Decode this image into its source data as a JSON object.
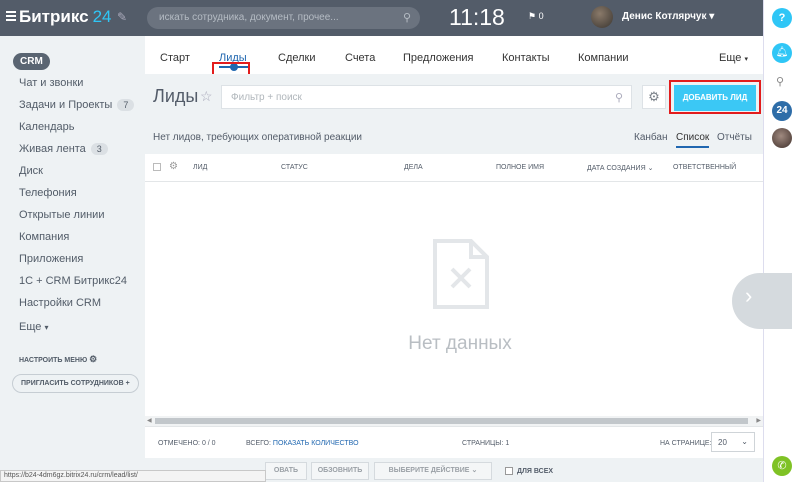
{
  "topbar": {
    "logo": "Битрикс",
    "logo_num": "24",
    "search_placeholder": "искать сотрудника, документ, прочее...",
    "clock": "11:18",
    "flag_count": "0",
    "username": "Денис Котлярчук"
  },
  "sidebar": {
    "crm": "CRM",
    "items": [
      {
        "label": "Чат и звонки"
      },
      {
        "label": "Задачи и Проекты",
        "count": "7"
      },
      {
        "label": "Календарь"
      },
      {
        "label": "Живая лента",
        "count": "3"
      },
      {
        "label": "Диск"
      },
      {
        "label": "Телефония"
      },
      {
        "label": "Открытые линии"
      },
      {
        "label": "Компания"
      },
      {
        "label": "Приложения"
      },
      {
        "label": "1С + CRM Битрикс24"
      },
      {
        "label": "Настройки CRM"
      },
      {
        "label": "Еще"
      }
    ],
    "configure": "НАСТРОИТЬ МЕНЮ",
    "invite": "ПРИГЛАСИТЬ СОТРУДНИКОВ"
  },
  "tabs": [
    "Старт",
    "Лиды",
    "Сделки",
    "Счета",
    "Предложения",
    "Контакты",
    "Компании",
    "Еще"
  ],
  "header": {
    "title": "Лиды",
    "filter_placeholder": "Фильтр + поиск",
    "add_button": "ДОБАВИТЬ ЛИД"
  },
  "info": {
    "text": "Нет лидов, требующих оперативной реакции",
    "views": [
      "Канбан",
      "Список",
      "Отчёты"
    ]
  },
  "columns": [
    "ЛИД",
    "СТАТУС",
    "ДЕЛА",
    "ПОЛНОЕ ИМЯ",
    "ДАТА СОЗДАНИЯ",
    "ОТВЕТСТВЕННЫЙ"
  ],
  "empty_text": "Нет данных",
  "footer": {
    "selected_label": "ОТМЕЧЕНО: 0 / 0",
    "total_label": "ВСЕГО:",
    "show_count": "ПОКАЗАТЬ КОЛИЧЕСТВО",
    "pages": "СТРАНИЦЫ: 1",
    "per_page_label": "НА СТРАНИЦЕ:",
    "per_page": "20"
  },
  "actions": {
    "edit_partial": "ОВАТЬ",
    "refresh": "ОБЗОВНИТЬ",
    "choose": "ВЫБЕРИТЕ ДЕЙСТВИЕ",
    "for_all": "ДЛЯ ВСЕХ"
  },
  "status_url": "https://b24-4dm6gz.bitrix24.ru/crm/lead/list/",
  "colors": {
    "topbar": "#535c69",
    "accent": "#3bc8f5",
    "link": "#2067b0",
    "highlight": "#e21c1c"
  }
}
